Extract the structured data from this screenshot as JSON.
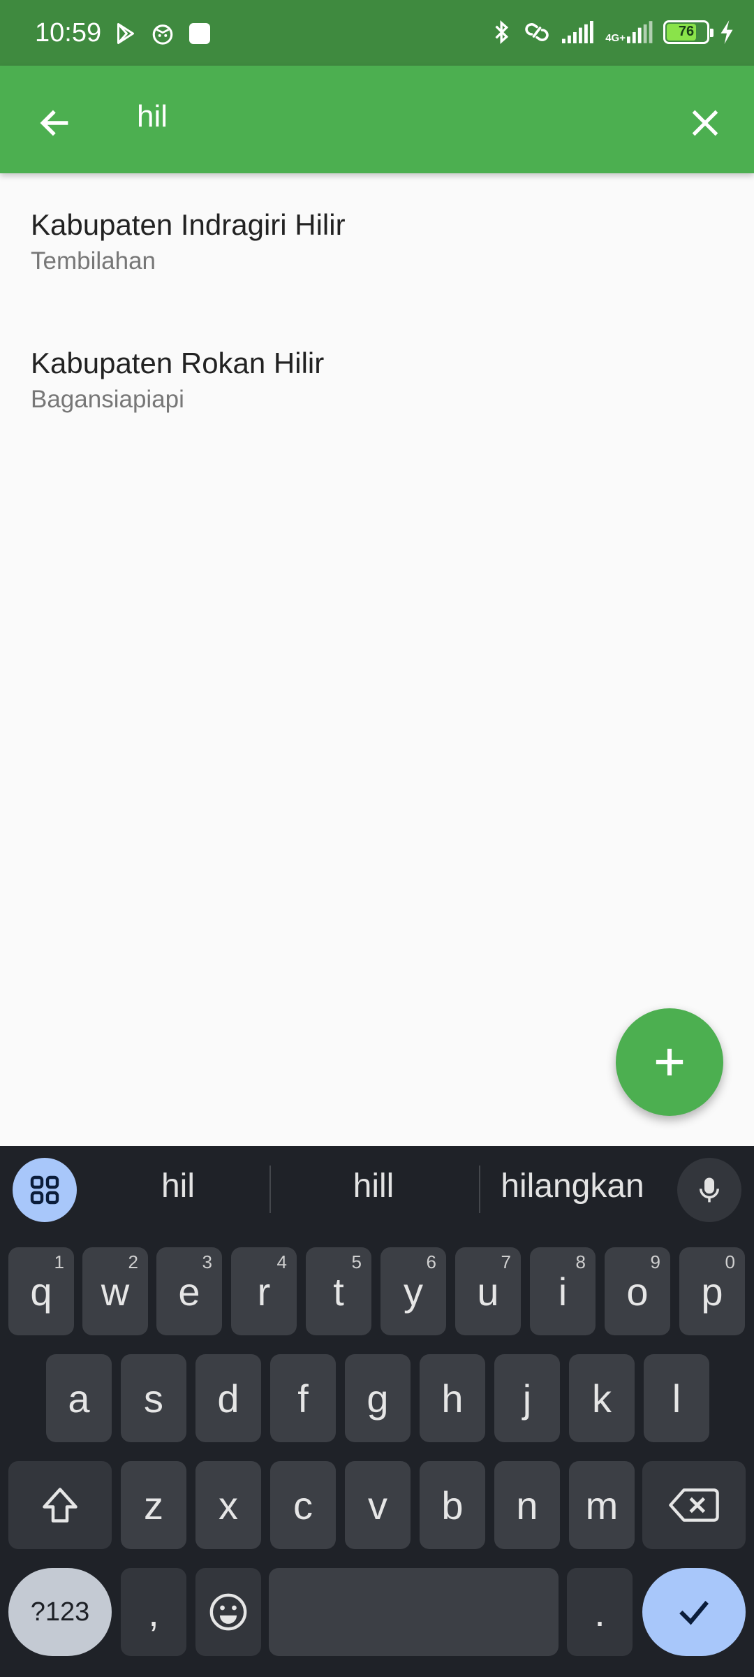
{
  "status_bar": {
    "time": "10:59",
    "left_icons": [
      "play-store-icon",
      "cat-face-icon",
      "square-app-icon"
    ],
    "right_icons": [
      "bluetooth-icon",
      "link-icon",
      "signal-icon",
      "signal-4g-icon",
      "battery-icon",
      "charging-bolt-icon"
    ],
    "network_label": "4G+",
    "battery_level": 76,
    "battery_text": "76"
  },
  "app_bar": {
    "search_query": "hil",
    "back_icon": "arrow-back-icon",
    "clear_icon": "close-icon"
  },
  "results": [
    {
      "title": "Kabupaten Indragiri Hilir",
      "subtitle": "Tembilahan"
    },
    {
      "title": "Kabupaten Rokan Hilir",
      "subtitle": "Bagansiapiapi"
    }
  ],
  "fab": {
    "icon": "plus-icon"
  },
  "keyboard": {
    "suggestions": [
      "hil",
      "hill",
      "hilangkan"
    ],
    "row1": [
      {
        "key": "q",
        "hint": "1"
      },
      {
        "key": "w",
        "hint": "2"
      },
      {
        "key": "e",
        "hint": "3"
      },
      {
        "key": "r",
        "hint": "4"
      },
      {
        "key": "t",
        "hint": "5"
      },
      {
        "key": "y",
        "hint": "6"
      },
      {
        "key": "u",
        "hint": "7"
      },
      {
        "key": "i",
        "hint": "8"
      },
      {
        "key": "o",
        "hint": "9"
      },
      {
        "key": "p",
        "hint": "0"
      }
    ],
    "row2": [
      "a",
      "s",
      "d",
      "f",
      "g",
      "h",
      "j",
      "k",
      "l"
    ],
    "row3": [
      "z",
      "x",
      "c",
      "v",
      "b",
      "n",
      "m"
    ],
    "symbols_label": "?123",
    "comma": ",",
    "period": "."
  },
  "colors": {
    "status_bar": "#3f8a3f",
    "app_bar": "#4caf50",
    "fab": "#4caf50",
    "keyboard_bg": "#1f2228",
    "key_bg": "#3c3f45",
    "accent_blue": "#a8c7fa"
  }
}
